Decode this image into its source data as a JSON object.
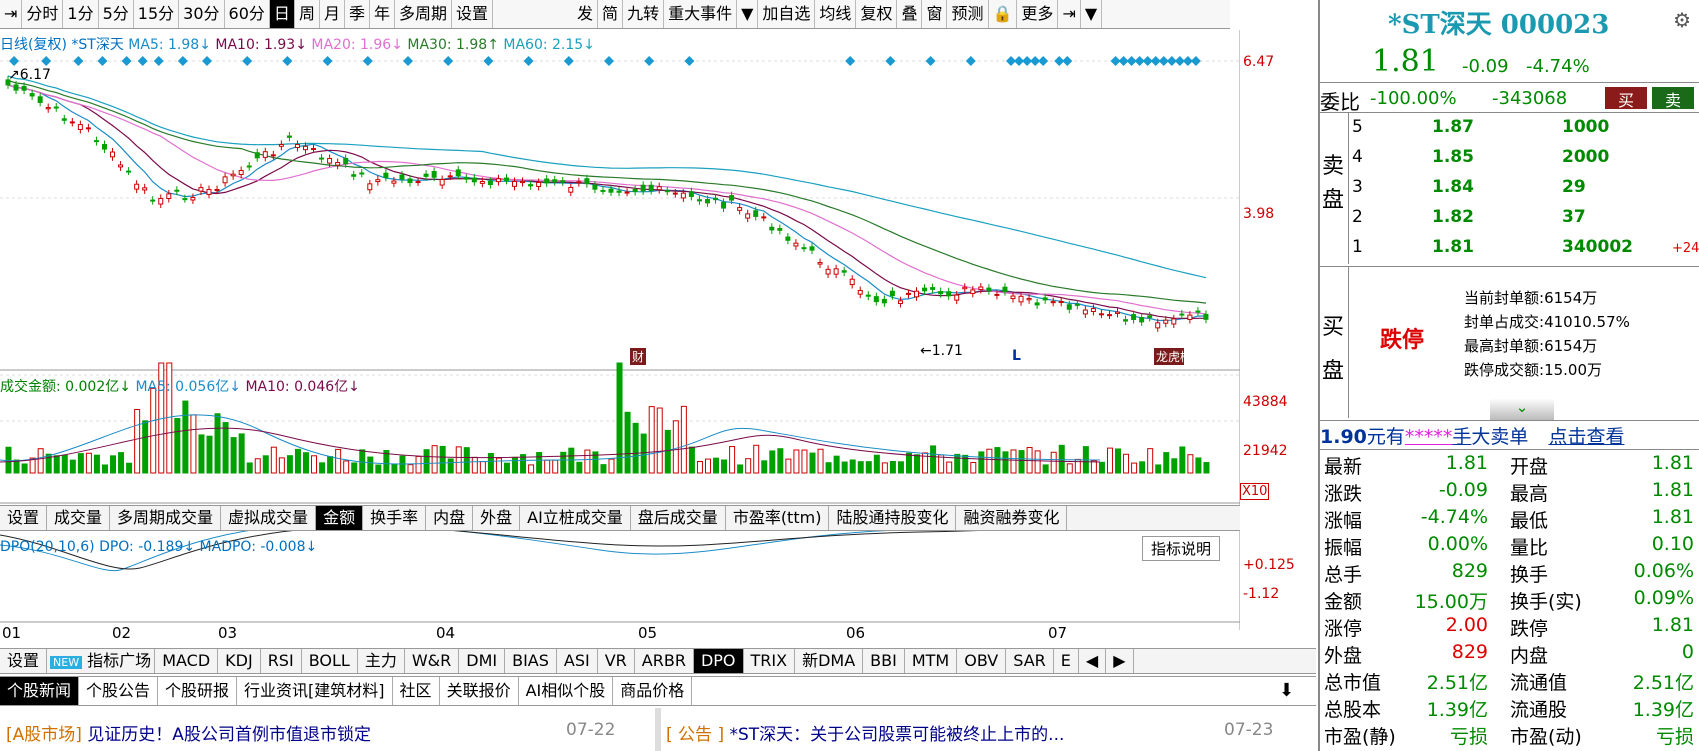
{
  "toolbar": {
    "left_icon": "⇥",
    "items": [
      "分时",
      "1分",
      "5分",
      "15分",
      "30分",
      "60分",
      "日",
      "周",
      "月",
      "季",
      "年",
      "多周期",
      "设置"
    ],
    "active": "日",
    "right": [
      "发",
      "简",
      "九转",
      "重大事件",
      "▼",
      "加自选",
      "均线",
      "复权",
      "叠",
      "窗",
      "预测",
      "🔒",
      "更多",
      "⇥",
      "▼"
    ]
  },
  "chart_legend": {
    "kline": "日线(复权)",
    "stock": "*ST深天",
    "ma5": "MA5: 1.98↓",
    "ma10": "MA10: 1.93↓",
    "ma20": "MA20: 1.96↓",
    "ma30": "MA30: 1.98↑",
    "ma60": "MA60: 2.15↓"
  },
  "price_axis": {
    "top": "6.47",
    "mid": "3.98"
  },
  "annotations": {
    "high": "6.17",
    "low": "1.71",
    "cai": "财",
    "bang": "龙虎榜",
    "L": "L"
  },
  "volume_legend": {
    "amount": "成交金额: 0.002亿↓",
    "ma5": "MA5: 0.056亿↓",
    "ma10": "MA10: 0.046亿↓"
  },
  "volume_axis": {
    "top": "43884",
    "mid": "21942",
    "unit": "X10"
  },
  "volume_tabs": [
    "设置",
    "成交量",
    "多周期成交量",
    "虚拟成交量",
    "金额",
    "换手率",
    "内盘",
    "外盘",
    "AI立桩成交量",
    "盘后成交量",
    "市盈率(ttm)",
    "陆股通持股变化",
    "融资融券变化"
  ],
  "volume_active": "金额",
  "dpo_legend": {
    "title": "DPO(20,10,6)",
    "dpo": "DPO: -0.189↓",
    "madpo": "MADPO: -0.008↓"
  },
  "dpo_axis": {
    "top": "+0.125",
    "bottom": "-1.12"
  },
  "indicator_btn": "指标说明",
  "date_axis": [
    "01",
    "02",
    "03",
    "04",
    "05",
    "06",
    "07"
  ],
  "indicator_tabs": [
    "设置",
    "NEW",
    "指标广场",
    "MACD",
    "KDJ",
    "RSI",
    "BOLL",
    "主力",
    "W&R",
    "DMI",
    "BIAS",
    "ASI",
    "VR",
    "ARBR",
    "DPO",
    "TRIX",
    "新DMA",
    "BBI",
    "MTM",
    "OBV",
    "SAR",
    "E"
  ],
  "indicator_active": "DPO",
  "news_tabs": [
    "个股新闻",
    "个股公告",
    "个股研报",
    "行业资讯[建筑材料]",
    "社区",
    "关联报价",
    "AI相似个股",
    "商品价格"
  ],
  "news": [
    {
      "tag": "[A股市场]",
      "title": "见证历史！A股公司首例市值退市锁定",
      "date": "07-22"
    },
    {
      "tag": "[  公告  ]",
      "title": "*ST深天：关于公司股票可能被终止上市的...",
      "date": "07-23"
    }
  ],
  "quote": {
    "name": "*ST深天",
    "code": "000023",
    "price": "1.81",
    "change": "-0.09",
    "pct": "-4.74%",
    "weibi_label": "委比",
    "weibi": "-100.00%",
    "weicha": "-343068",
    "buy": "买",
    "sell": "卖"
  },
  "sell_label": [
    "卖",
    "盘"
  ],
  "sells": [
    {
      "lvl": "5",
      "p": "1.87",
      "v": "1000"
    },
    {
      "lvl": "4",
      "p": "1.85",
      "v": "2000"
    },
    {
      "lvl": "3",
      "p": "1.84",
      "v": "29"
    },
    {
      "lvl": "2",
      "p": "1.82",
      "v": "37"
    },
    {
      "lvl": "1",
      "p": "1.81",
      "v": "340002",
      "d": "+24"
    }
  ],
  "buy_label": [
    "买",
    "盘"
  ],
  "limit": {
    "status": "跌停",
    "l1": "当前封单额:",
    "v1": "6154万",
    "l2": "封单占成交:",
    "v2": "41010.57%",
    "l3": "最高封单额:",
    "v3": "6154万",
    "l4": "跌停成交额:",
    "v4": "15.00万"
  },
  "big": {
    "a": "1.90",
    "b": "元有",
    "c": "*****",
    "d": "手",
    "e": "大卖单",
    "f": "点击查看"
  },
  "stats": [
    [
      "最新",
      "1.81",
      "开盘",
      "1.81"
    ],
    [
      "涨跌",
      "-0.09",
      "最高",
      "1.81"
    ],
    [
      "涨幅",
      "-4.74%",
      "最低",
      "1.81"
    ],
    [
      "振幅",
      "0.00%",
      "量比",
      "0.10"
    ],
    [
      "总手",
      "829",
      "换手",
      "0.06%"
    ],
    [
      "金额",
      "15.00万",
      "换手(实)",
      "0.09%"
    ],
    [
      "涨停",
      "2.00",
      "跌停",
      "1.81"
    ],
    [
      "外盘",
      "829",
      "内盘",
      "0"
    ],
    [
      "总市值",
      "2.51亿",
      "流通值",
      "2.51亿"
    ],
    [
      "总股本",
      "1.39亿",
      "流通股",
      "1.39亿"
    ],
    [
      "市盈(静)",
      "亏损",
      "市盈(动)",
      "亏损"
    ]
  ]
}
